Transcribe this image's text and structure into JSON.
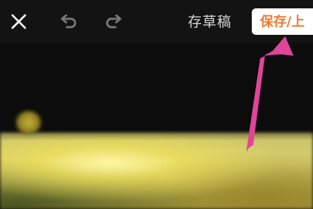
{
  "toolbar": {
    "close_icon": "close-icon",
    "undo_icon": "undo-icon",
    "redo_icon": "redo-icon",
    "draft_label": "存草稿",
    "save_label": "保存/上"
  },
  "content": {
    "logo_icon": "blurred-logo-icon"
  },
  "annotation": {
    "arrow_color": "#e0459a"
  },
  "colors": {
    "save_text": "#ee7a2d",
    "save_bg": "#ffffff",
    "toolbar_text": "#d9d9d9"
  }
}
